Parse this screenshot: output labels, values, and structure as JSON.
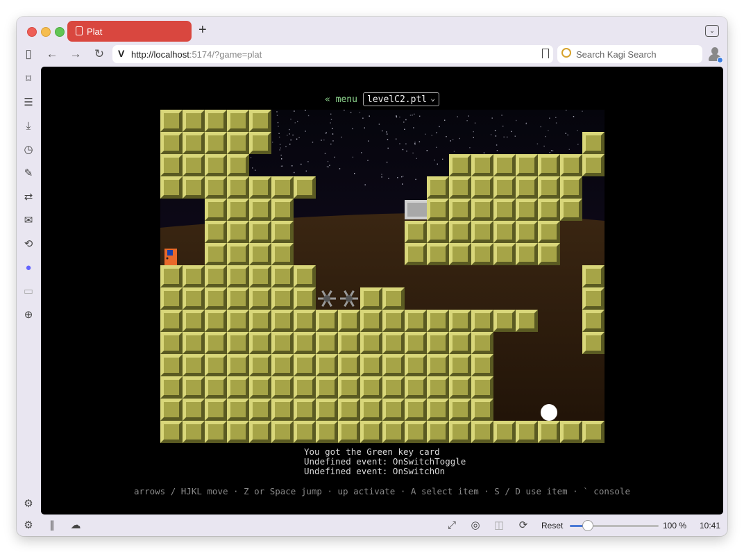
{
  "browser": {
    "tab_title": "Plat",
    "url_host": "http://localhost",
    "url_rest": ":5174/?game=plat",
    "search_placeholder": "Search Kagi Search"
  },
  "toolbar_icons": [
    "sidebar-toggle-icon",
    "back-icon",
    "forward-icon",
    "reload-icon",
    "vivaldi-icon",
    "bookmark-icon",
    "search-engine-icon",
    "profile-icon"
  ],
  "sidebar_icons": [
    "bookmarks-icon",
    "reading-list-icon",
    "downloads-icon",
    "history-icon",
    "notes-icon",
    "translate-icon",
    "mail-icon",
    "sync-icon",
    "mastodon-icon",
    "document-icon",
    "add-panel-icon",
    "settings-icon"
  ],
  "game": {
    "menu_link": "« menu",
    "level_file": "levelC2.ptl",
    "log_lines": [
      "You got the Green key card",
      "Undefined event: OnSwitchToggle",
      "Undefined event: OnSwitchOn"
    ],
    "help": "arrows / HJKL move · Z or Space jump · up activate · A select item · S / D use item · ` console",
    "grid": [
      "#####...............#",
      "#####..............##",
      "####.........#######",
      "#######.....#######",
      "..####.....&#######",
      "..####.....#######",
      "D.####.....#######",
      "#######............#",
      "#######**##........#",
      "#################..#",
      "###############....##",
      "###############.....#",
      "###############.....#",
      "###############..o..#",
      "####################"
    ],
    "colors": {
      "brick": "#a6a447",
      "brick_light": "#d9d77a",
      "brick_dark": "#5a5a22",
      "dirt": "#2e1c0c",
      "sky": "#0c0818",
      "door": "#e8692a"
    }
  },
  "statusbar": {
    "reset_label": "Reset",
    "zoom_value": 100,
    "zoom_label": "100 %",
    "clock": "10:41"
  }
}
